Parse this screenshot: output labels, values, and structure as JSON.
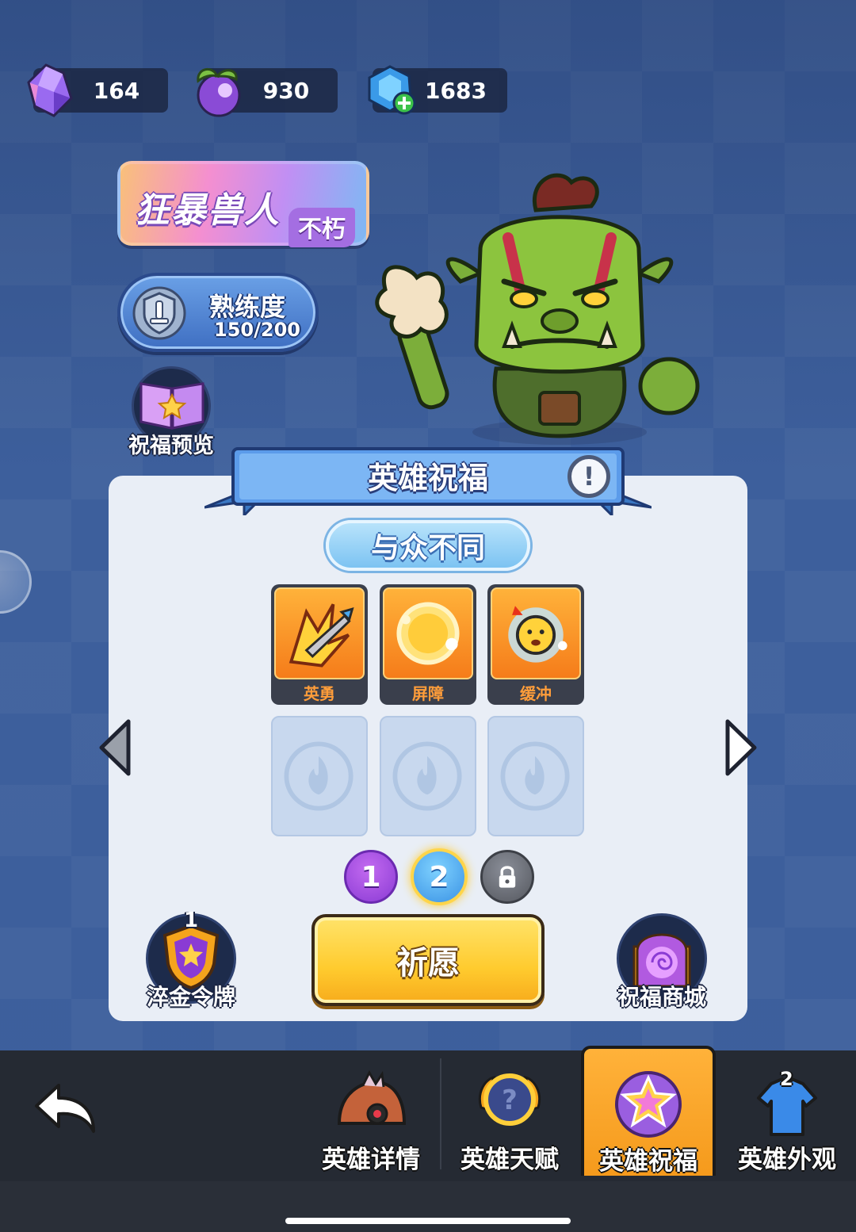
{
  "currencies": [
    {
      "name": "crystal-icon",
      "value": "164"
    },
    {
      "name": "potion-icon",
      "value": "930"
    },
    {
      "name": "blue-gem-icon",
      "value": "1683"
    }
  ],
  "hero": {
    "name": "狂暴兽人",
    "rank": "不朽",
    "proficiency_label": "熟练度",
    "proficiency_value": "150/200",
    "preview_label": "祝福预览"
  },
  "panel": {
    "title": "英雄祝福",
    "info_symbol": "!",
    "subtitle": "与众不同",
    "skills": [
      {
        "label": "英勇",
        "icon": "arrow-blast-icon"
      },
      {
        "label": "屏障",
        "icon": "orb-icon"
      },
      {
        "label": "缓冲",
        "icon": "dizzy-face-icon"
      }
    ],
    "pages": [
      "1",
      "2"
    ],
    "token_label": "淬金令牌",
    "token_count": "1",
    "wish_label": "祈愿",
    "shop_label": "祝福商城"
  },
  "nav": {
    "tabs": [
      {
        "label": "英雄详情"
      },
      {
        "label": "英雄天赋"
      },
      {
        "label": "英雄祝福"
      },
      {
        "label": "英雄外观"
      }
    ],
    "skin_badge": "2"
  },
  "colors": {
    "accent_orange": "#ffb23a",
    "background_blue": "#3d5f9c",
    "panel_bg": "#e9eef6",
    "wish_yellow": "#ffcb2e"
  }
}
